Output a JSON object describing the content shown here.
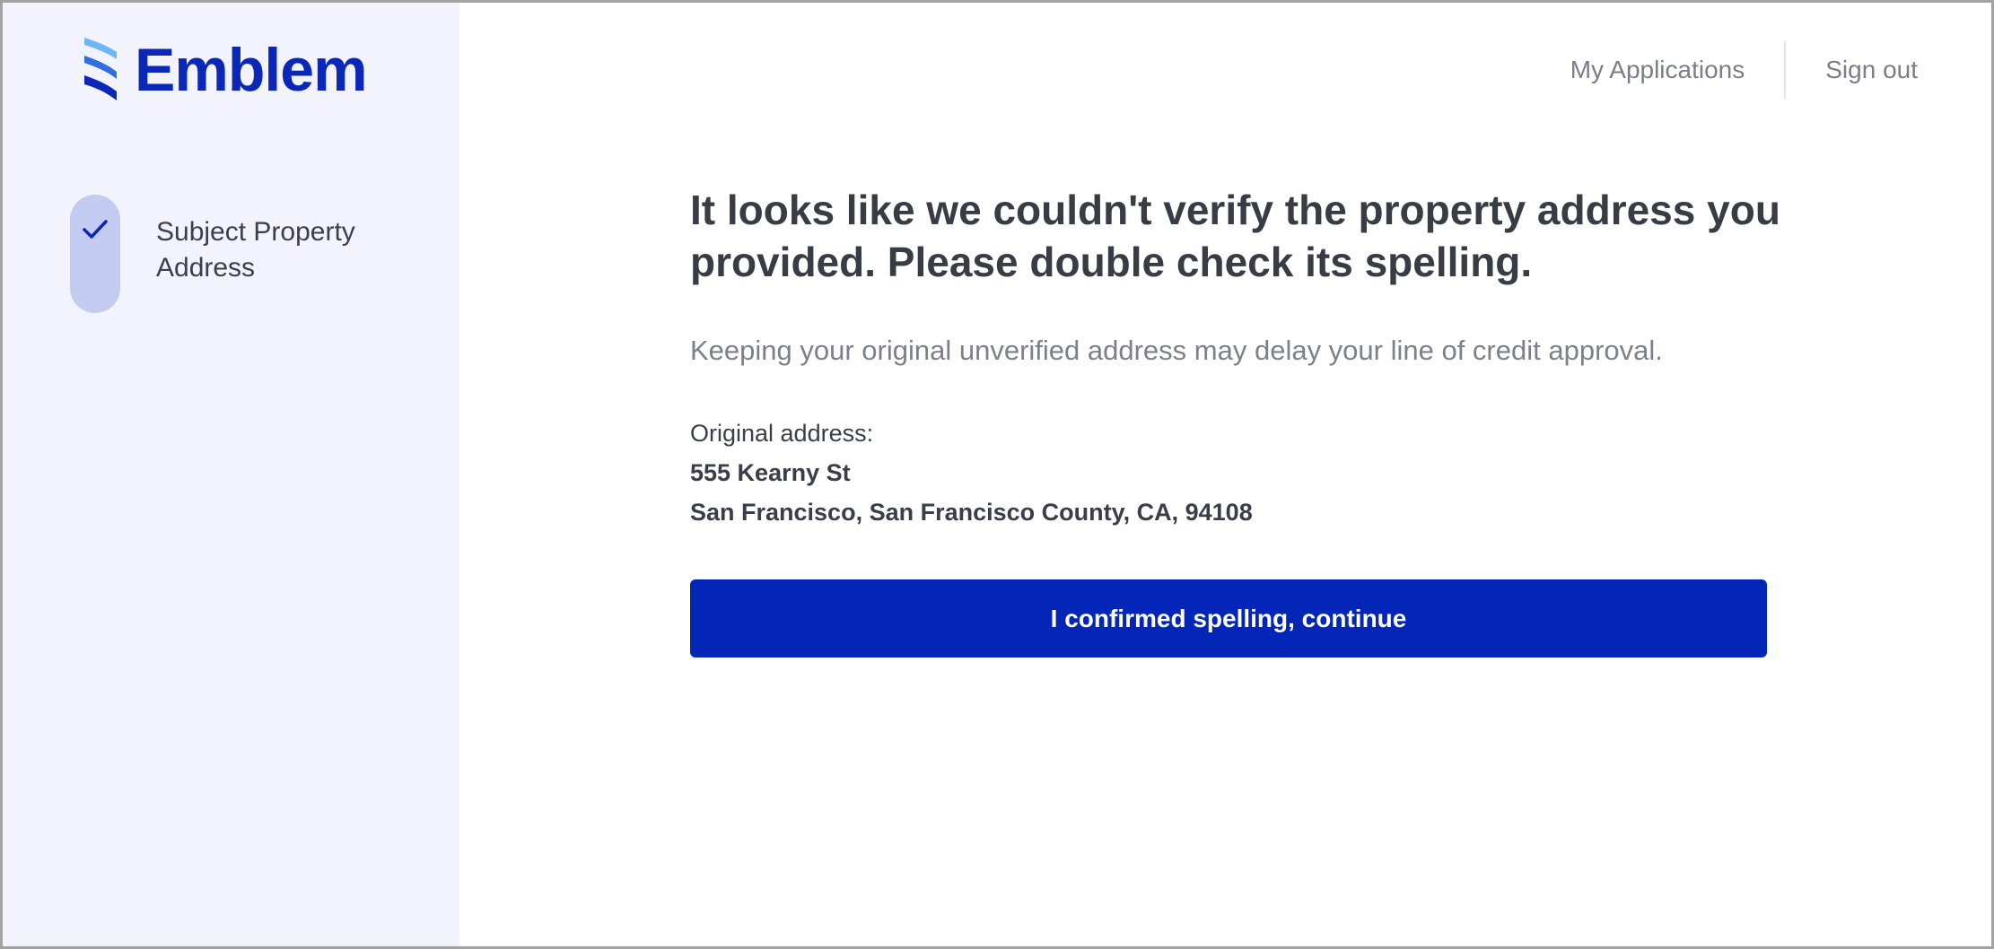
{
  "brand": {
    "name": "Emblem",
    "accent_color": "#0325b8",
    "logo_icon": "emblem-stripes-icon"
  },
  "sidebar": {
    "steps": [
      {
        "label": "Subject Property\nAddress",
        "status": "completed",
        "icon": "checkmark-icon"
      }
    ]
  },
  "topnav": {
    "my_applications": "My Applications",
    "sign_out": "Sign out"
  },
  "main": {
    "heading": "It looks like we couldn't verify the property address you provided. Please double check its spelling.",
    "subtext": "Keeping your original unverified address may delay your line of credit approval.",
    "address_label": "Original address:",
    "address_line1": "555 Kearny St",
    "address_line2": "San Francisco, San Francisco County, CA, 94108",
    "confirm_button": "I confirmed spelling, continue"
  }
}
